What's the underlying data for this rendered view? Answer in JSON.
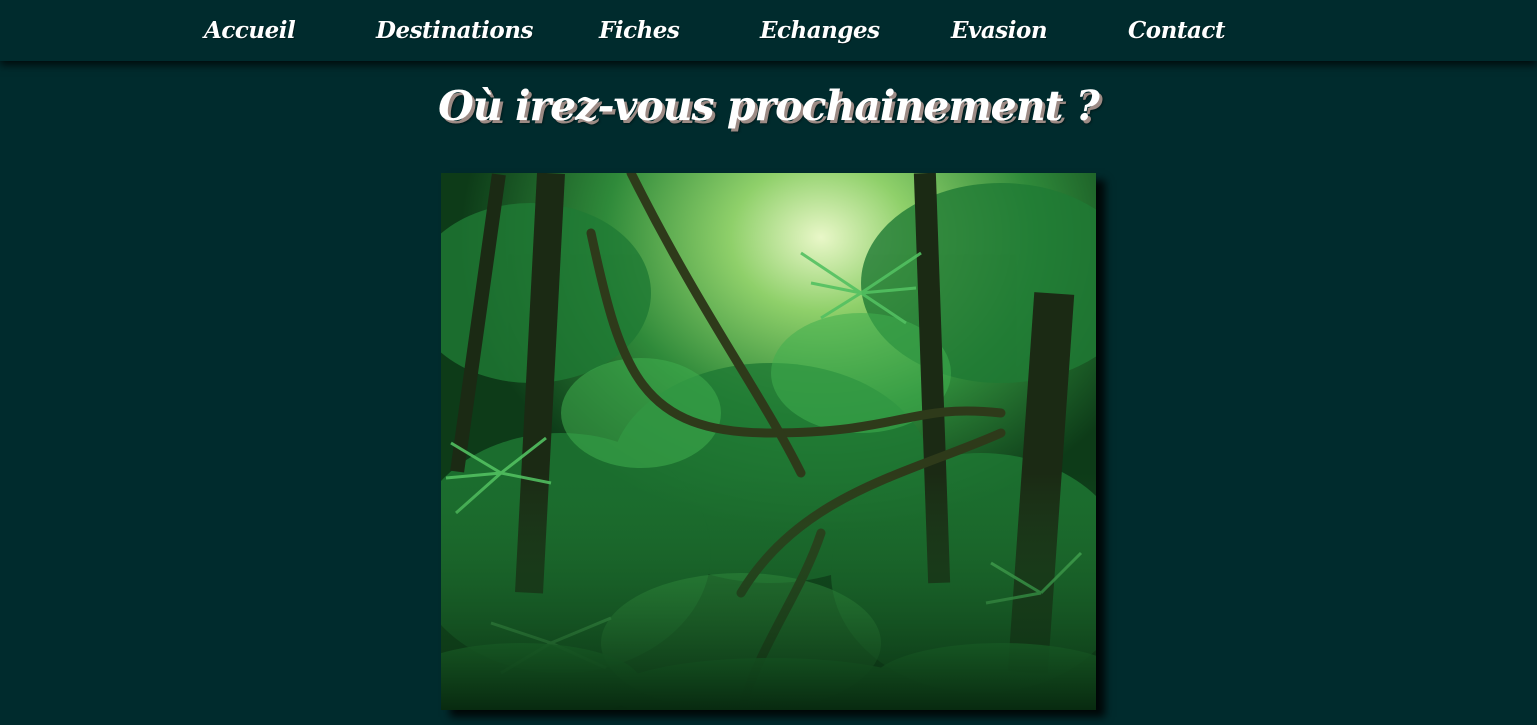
{
  "nav": {
    "items": [
      {
        "label": "Accueil"
      },
      {
        "label": "Destinations"
      },
      {
        "label": "Fiches"
      },
      {
        "label": "Echanges"
      },
      {
        "label": "Evasion"
      },
      {
        "label": "Contact"
      }
    ]
  },
  "main": {
    "title": "Où irez-vous prochainement ?",
    "image": {
      "subject": "tropical rainforest with vines and palm leaves"
    }
  },
  "colors": {
    "background": "#002b2d",
    "nav_text": "#ffffff",
    "title_text": "#ffffff",
    "title_shadow": "#9c8a84"
  }
}
